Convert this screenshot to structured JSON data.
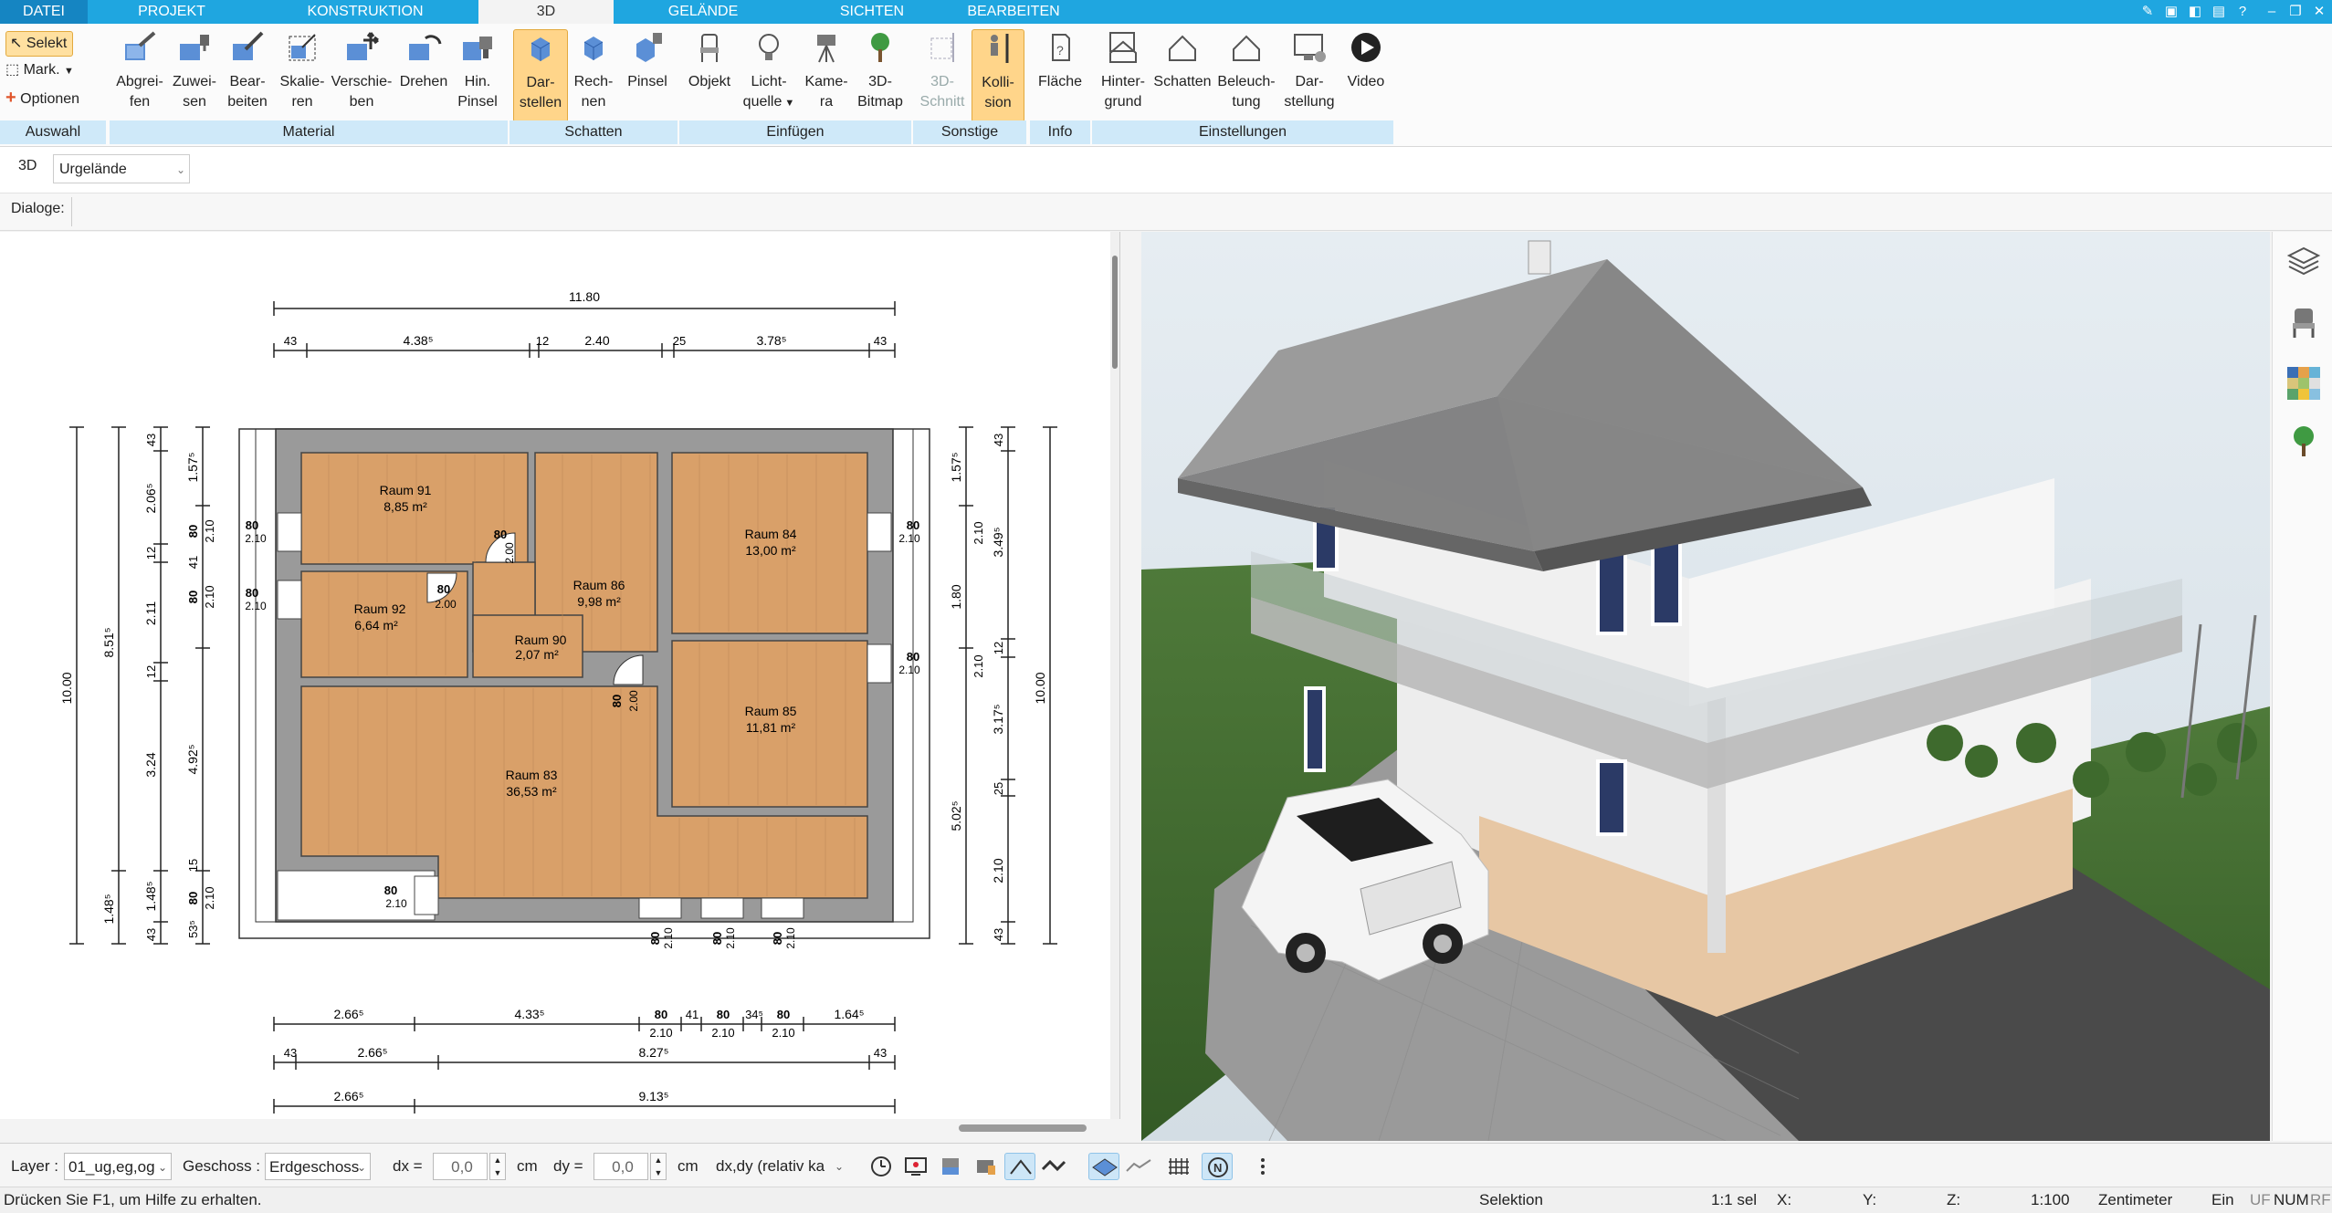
{
  "menu": {
    "tabs": [
      "DATEI",
      "PROJEKT",
      "KONSTRUKTION",
      "3D",
      "GELÄNDE",
      "SICHTEN",
      "BEARBEITEN"
    ],
    "active": "3D"
  },
  "ribbon": {
    "auswahl": {
      "selekt": "Selekt",
      "mark": "Mark.",
      "optionen": "Optionen",
      "group": "Auswahl"
    },
    "material": {
      "group": "Material",
      "buttons": [
        {
          "l1": "Abgrei-",
          "l2": "fen"
        },
        {
          "l1": "Zuwei-",
          "l2": "sen"
        },
        {
          "l1": "Bear-",
          "l2": "beiten"
        },
        {
          "l1": "Skalie-",
          "l2": "ren"
        },
        {
          "l1": "Verschie-",
          "l2": "ben"
        },
        {
          "l1": "Drehen",
          "l2": ""
        },
        {
          "l1": "Hin.",
          "l2": "Pinsel"
        }
      ]
    },
    "schatten": {
      "group": "Schatten",
      "buttons": [
        {
          "l1": "Dar-",
          "l2": "stellen"
        },
        {
          "l1": "Rech-",
          "l2": "nen"
        },
        {
          "l1": "Pinsel",
          "l2": ""
        }
      ]
    },
    "einfuegen": {
      "group": "Einfügen",
      "buttons": [
        {
          "l1": "Objekt",
          "l2": ""
        },
        {
          "l1": "Licht-",
          "l2": "quelle"
        },
        {
          "l1": "Kame-",
          "l2": "ra"
        },
        {
          "l1": "3D-",
          "l2": "Bitmap"
        }
      ]
    },
    "sonstige": {
      "group": "Sonstige",
      "buttons": [
        {
          "l1": "3D-",
          "l2": "Schnitt"
        },
        {
          "l1": "Kolli-",
          "l2": "sion"
        }
      ]
    },
    "info": {
      "group": "Info",
      "buttons": [
        {
          "l1": "Fläche",
          "l2": ""
        }
      ]
    },
    "einstellungen": {
      "group": "Einstellungen",
      "buttons": [
        {
          "l1": "Hinter-",
          "l2": "grund"
        },
        {
          "l1": "Schatten",
          "l2": ""
        },
        {
          "l1": "Beleuch-",
          "l2": "tung"
        },
        {
          "l1": "Dar-",
          "l2": "stellung"
        },
        {
          "l1": "Video",
          "l2": ""
        }
      ]
    }
  },
  "toolbar2": {
    "mode": "3D",
    "layer_select": "Urgelände"
  },
  "toolbar3": {
    "dialoge_label": "Dialoge:"
  },
  "plan": {
    "rooms": [
      {
        "name": "Raum 91",
        "area": "8,85 m²"
      },
      {
        "name": "Raum 86",
        "area": "9,98 m²"
      },
      {
        "name": "Raum 84",
        "area": "13,00 m²"
      },
      {
        "name": "Raum 92",
        "area": "6,64 m²"
      },
      {
        "name": "Raum 90",
        "area": "2,07 m²"
      },
      {
        "name": "Raum 85",
        "area": "11,81 m²"
      },
      {
        "name": "Raum 83",
        "area": "36,53 m²"
      }
    ],
    "dims_top": {
      "total": "11.80",
      "chain": [
        "43",
        "4.38⁵",
        "12",
        "2.40",
        "25",
        "3.78⁵",
        "43"
      ]
    },
    "dims_bottom": {
      "row1": [
        "2.66⁵",
        "4.33⁵",
        "80",
        "41",
        "80",
        "34⁵",
        "80",
        "1.64⁵"
      ],
      "row1_sub": [
        "2.10",
        "2.10",
        "2.10"
      ],
      "row2": [
        "43",
        "2.66⁵",
        "8.27⁵",
        "43"
      ],
      "row3": [
        "2.66⁵",
        "9.13⁵"
      ]
    },
    "dims_left": {
      "total": "10.00",
      "outer": [
        "8.51⁵",
        "1.48⁵"
      ],
      "chain": [
        "43",
        "2.06⁵",
        "12",
        "2.11",
        "12",
        "3.24",
        "1.48⁵",
        "43"
      ],
      "inner": [
        "1.57⁵",
        "4.92⁵",
        "53⁵"
      ],
      "openings": [
        "80",
        "2.10",
        "41",
        "80",
        "2.10",
        "15",
        "80",
        "2.10"
      ]
    },
    "dims_right": {
      "total": "10.00",
      "chain": [
        "43",
        "1.57⁵",
        "3.49⁵",
        "12",
        "3.17⁵",
        "25",
        "5.02⁵",
        "2.10",
        "43"
      ],
      "inner": [
        "2.10",
        "1.80",
        "2.10"
      ]
    },
    "window_labels": [
      {
        "a": "80",
        "b": "2.10"
      },
      {
        "a": "80",
        "b": "2.00"
      }
    ]
  },
  "status": {
    "layer_label": "Layer :",
    "layer_value": "01_ug,eg,og",
    "geschoss_label": "Geschoss :",
    "geschoss_value": "Erdgeschoss",
    "dx_label": "dx =",
    "dx_value": "0,0",
    "dy_label": "dy =",
    "dy_value": "0,0",
    "unit1": "cm",
    "unit2": "cm",
    "mode_value": "dx,dy (relativ ka"
  },
  "statusline": {
    "help": "Drücken Sie F1, um Hilfe zu erhalten.",
    "mode": "Selektion",
    "sel": "1:1 sel",
    "x": "X:",
    "y": "Y:",
    "z": "Z:",
    "scale": "1:100",
    "unit": "Zentimeter",
    "ein": "Ein",
    "uf": "UF",
    "num": "NUM",
    "rf": "RF"
  },
  "colors": {
    "accent": "#1fa6e0",
    "group_band": "#cfe9f9",
    "floor": "#d9a069",
    "wall": "#9a9a9a"
  }
}
